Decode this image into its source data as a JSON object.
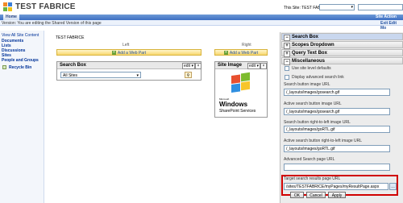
{
  "header": {
    "title": "TEST FABRICE",
    "scope_label": "This Site: TEST FABRICE",
    "home_tab": "Home",
    "site_actions": "Site Action",
    "version_text": "Version: You are editing the Shared Version of this page",
    "exit_edit": "Exit Edit Mo"
  },
  "leftnav": {
    "view_all": "View All Site Content",
    "items": [
      "Documents",
      "Lists",
      "Discussions",
      "Sites",
      "People and Groups"
    ],
    "recycle": "Recycle Bin"
  },
  "main": {
    "crumb": "TEST FABRICE",
    "left_zone": "Left",
    "right_zone": "Right",
    "add_web_part": "Add a Web Part",
    "search_wp_title": "Search Box",
    "edit": "edit",
    "scope_value": "All Sites",
    "image_wp_title": "Site Image",
    "logo_microsoft": "Microsoft",
    "logo_windows": "Windows",
    "logo_sps": "SharePoint Services"
  },
  "toolpane": {
    "title": "Search Box",
    "sections": [
      "Scopes Dropdown",
      "Query Text Box",
      "Miscellaneous"
    ],
    "use_site_defaults": "Use site level defaults",
    "display_advanced": "Display advanced search link",
    "fields": [
      {
        "label": "Search button image URL",
        "value": "/_layouts/images/gosearch.gif"
      },
      {
        "label": "Active search button image URL",
        "value": "/_layouts/images/gosearch.gif"
      },
      {
        "label": "Search button right-to-left image URL",
        "value": "/_layouts/images/goRTL.gif"
      },
      {
        "label": "Active search button right-to-left image URL",
        "value": "/_layouts/images/goRTL.gif"
      },
      {
        "label": "Advanced Search page URL",
        "value": ""
      },
      {
        "label": "Target search results page URL",
        "value": "/sites/TESTFABRICE/myPages/myResultPage.aspx"
      }
    ],
    "ok": "OK",
    "cancel": "Cancel",
    "apply": "Apply"
  },
  "colors": {
    "accent": "#3c6fc3",
    "highlight": "#d00000"
  }
}
